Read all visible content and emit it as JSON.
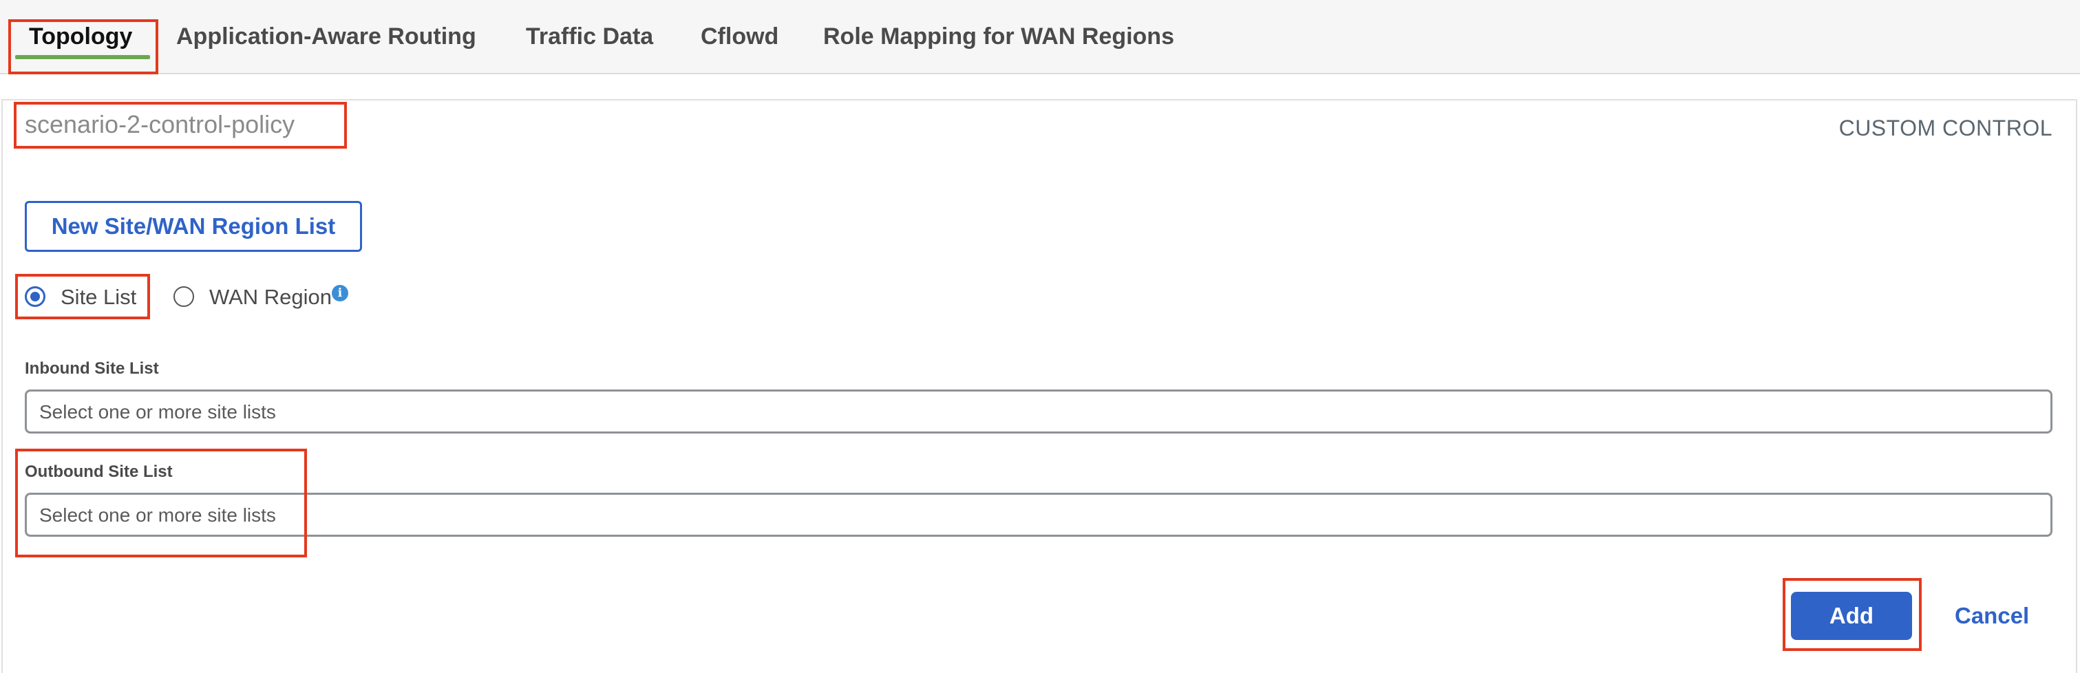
{
  "tabs": [
    {
      "label": "Topology",
      "active": true
    },
    {
      "label": "Application-Aware Routing",
      "active": false
    },
    {
      "label": "Traffic Data",
      "active": false
    },
    {
      "label": "Cflowd",
      "active": false
    },
    {
      "label": "Role Mapping for WAN Regions",
      "active": false
    }
  ],
  "policy": {
    "name": "scenario-2-control-policy",
    "type": "CUSTOM CONTROL"
  },
  "new_list_button": "New Site/WAN Region List",
  "radio_options": [
    {
      "label": "Site List",
      "checked": true
    },
    {
      "label": "WAN Region",
      "checked": false,
      "icon": "info-icon"
    }
  ],
  "inbound": {
    "label": "Inbound Site List",
    "placeholder": "Select one or more site lists"
  },
  "outbound": {
    "label": "Outbound Site List",
    "placeholder": "Select one or more site lists"
  },
  "actions": {
    "add_label": "Add",
    "cancel_label": "Cancel"
  },
  "colors": {
    "accent": "#2f63c8",
    "active_tab_underline": "#6aa84f",
    "annotation_highlight": "#e5391e",
    "info_icon": "#3b8ed6"
  }
}
